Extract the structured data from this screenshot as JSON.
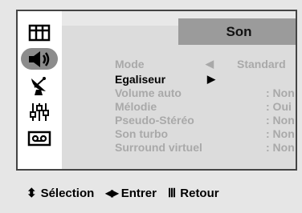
{
  "menu": {
    "title": "Son",
    "items": [
      {
        "label": "Mode",
        "value": "Standard",
        "left_arrow": "◀",
        "right_arrow": "▶"
      },
      {
        "label": "Egaliseur",
        "arrow": "▶"
      },
      {
        "label": "Volume auto",
        "value": ": Non"
      },
      {
        "label": "Mélodie",
        "value": ": Oui"
      },
      {
        "label": "Pseudo-Stéréo",
        "value": ": Non"
      },
      {
        "label": "Son turbo",
        "value": ": Non"
      },
      {
        "label": "Surround virtuel",
        "value": ": Non"
      }
    ]
  },
  "sidebar": {
    "icons": [
      "picture-icon",
      "speaker-icon",
      "satellite-dish-icon",
      "equalizer-sliders-icon",
      "tape-icon"
    ],
    "active_index": 1
  },
  "footer": {
    "select_glyph": "⬍",
    "select_label": "Sélection",
    "enter_glyph": "◀▶",
    "enter_label": "Entrer",
    "return_glyph": "Ⅲ",
    "return_label": "Retour"
  },
  "colors": {
    "active_text": "#000000",
    "inactive_text": "#a9a9a9",
    "title_tab": "#9b9b9b",
    "active_icon_pill": "#8c8c8c"
  }
}
